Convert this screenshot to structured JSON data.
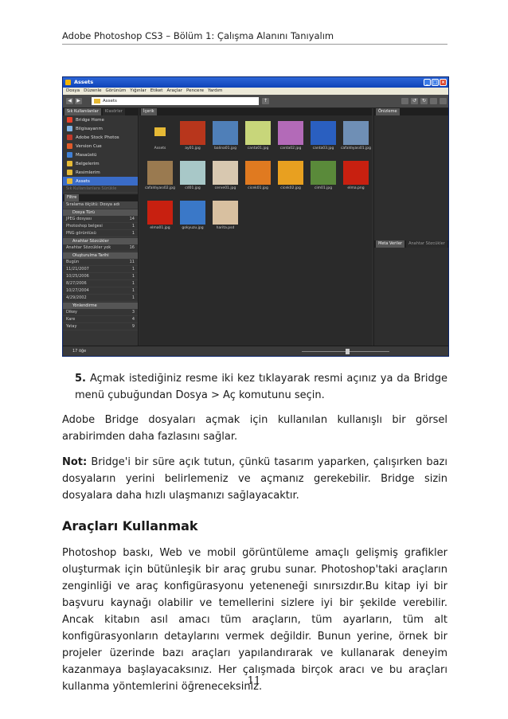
{
  "header": "Adobe Photoshop CS3 – Bölüm 1: Çalışma Alanını Tanıyalım",
  "screenshot": {
    "title": "Assets",
    "menu": [
      "Dosya",
      "Düzenle",
      "Görünüm",
      "Yığınlar",
      "Etiket",
      "Araçlar",
      "Pencere",
      "Yardım"
    ],
    "path_label": "Assets",
    "left_tabs": [
      "Sık Kullanılanlar",
      "Klasörler"
    ],
    "favorites": [
      {
        "label": "Bridge Home",
        "color": "#e8402a"
      },
      {
        "label": "Bilgisayarım",
        "color": "#7fb3e6"
      },
      {
        "label": "Adobe Stock Photos",
        "color": "#c0392b"
      },
      {
        "label": "Version Cue",
        "color": "#e05a2a"
      },
      {
        "label": "Masaüstü",
        "color": "#3f7fd6"
      },
      {
        "label": "Belgelerim",
        "color": "#e6b935"
      },
      {
        "label": "Resimlerim",
        "color": "#e6b935"
      },
      {
        "label": "Assets",
        "color": "#e6b935"
      }
    ],
    "favorites_extra": "Sık Kullanılanlara Sürükle",
    "filter_tab": "Filtre",
    "sort_label": "Sıralama ölçütü: Dosya adı",
    "filter_groups": [
      {
        "title": "Dosya Türü",
        "items": [
          {
            "label": "JPEG dosyası",
            "count": "14"
          },
          {
            "label": "Photoshop belgesi",
            "count": "1"
          },
          {
            "label": "PNG görüntüsü",
            "count": "1"
          }
        ]
      },
      {
        "title": "Anahtar Sözcükler",
        "items": [
          {
            "label": "Anahtar Sözcükler yok",
            "count": "16"
          }
        ]
      },
      {
        "title": "Oluşturulma Tarihi",
        "items": [
          {
            "label": "Bugün",
            "count": "11"
          },
          {
            "label": "11/21/2007",
            "count": "1"
          },
          {
            "label": "10/25/2006",
            "count": "1"
          },
          {
            "label": "8/27/2006",
            "count": "1"
          },
          {
            "label": "10/27/2004",
            "count": "1"
          },
          {
            "label": "4/29/2002",
            "count": "1"
          }
        ]
      },
      {
        "title": "Yönlendirme",
        "items": [
          {
            "label": "Dikey",
            "count": "3"
          },
          {
            "label": "Kare",
            "count": "4"
          },
          {
            "label": "Yatay",
            "count": "9"
          }
        ]
      }
    ],
    "content_tab": "İçerik",
    "thumbnails": [
      {
        "name": "Assets",
        "color": "#e6b935"
      },
      {
        "name": "ay01.jpg",
        "color": "#b8361c"
      },
      {
        "name": "balina01.jpg",
        "color": "#4f7fb8"
      },
      {
        "name": "canta01.jpg",
        "color": "#c8d67a"
      },
      {
        "name": "canta02.jpg",
        "color": "#b36ab8"
      },
      {
        "name": "canta03.jpg",
        "color": "#2a5fc0"
      },
      {
        "name": "cafaldıyası01.jpg",
        "color": "#6f8fb5"
      },
      {
        "name": "cafaldıyası02.jpg",
        "color": "#9a7a50"
      },
      {
        "name": "cd01.jpg",
        "color": "#a8c8c8"
      },
      {
        "name": "cerve01.jpg",
        "color": "#d8c8b0"
      },
      {
        "name": "cicek01.jpg",
        "color": "#e07a20"
      },
      {
        "name": "cicek02.jpg",
        "color": "#e8a020"
      },
      {
        "name": "cim01.jpg",
        "color": "#5a8a3a"
      },
      {
        "name": "elma.png",
        "color": "#c82010"
      },
      {
        "name": "elma01.jpg",
        "color": "#c82010"
      },
      {
        "name": "gokyuzu.jpg",
        "color": "#3a78c8"
      },
      {
        "name": "harita.psd",
        "color": "#d8c0a0"
      }
    ],
    "right_tabs_top": [
      "Önizleme"
    ],
    "right_tabs_bottom": [
      "Meta Veriler",
      "Anahtar Sözcükler"
    ],
    "status": "17 öğe"
  },
  "step": {
    "number": "5.",
    "text": "Açmak istediğiniz resme iki kez tıklayarak resmi açınız ya da Bridge menü çubuğundan Dosya > Aç komutunu seçin."
  },
  "para1": "Adobe Bridge dosyaları açmak için kullanılan kullanışlı bir görsel arabirimden daha fazlasını sağlar.",
  "note_label": "Not:",
  "note_text": " Bridge'i bir süre açık tutun, çünkü tasarım yaparken, çalışırken bazı dosyaların yerini belirlemeniz ve açmanız gerekebilir. Bridge sizin dosyalara daha hızlı ulaşmanızı sağlayacaktır.",
  "heading": "Araçları Kullanmak",
  "para2": "Photoshop baskı, Web ve mobil görüntüleme amaçlı gelişmiş grafikler oluşturmak için bütünleşik bir araç grubu sunar. Photoshop'taki araçların zenginliği ve araç konfigürasyonu yeteneneği sınırsızdır.Bu kitap iyi bir başvuru kaynağı olabilir ve temellerini sizlere iyi bir şekilde verebilir. Ancak kitabın asıl amacı tüm araçların, tüm ayarların, tüm alt konfigürasyonların detaylarını vermek değildir. Bunun yerine, örnek bir projeler üzerinde bazı araçları yapılandırarak ve kullanarak deneyim kazanmaya başlayacaksınız. Her çalışmada birçok aracı ve bu araçları kullanma yöntemlerini öğreneceksiniz.",
  "page_number": "11"
}
